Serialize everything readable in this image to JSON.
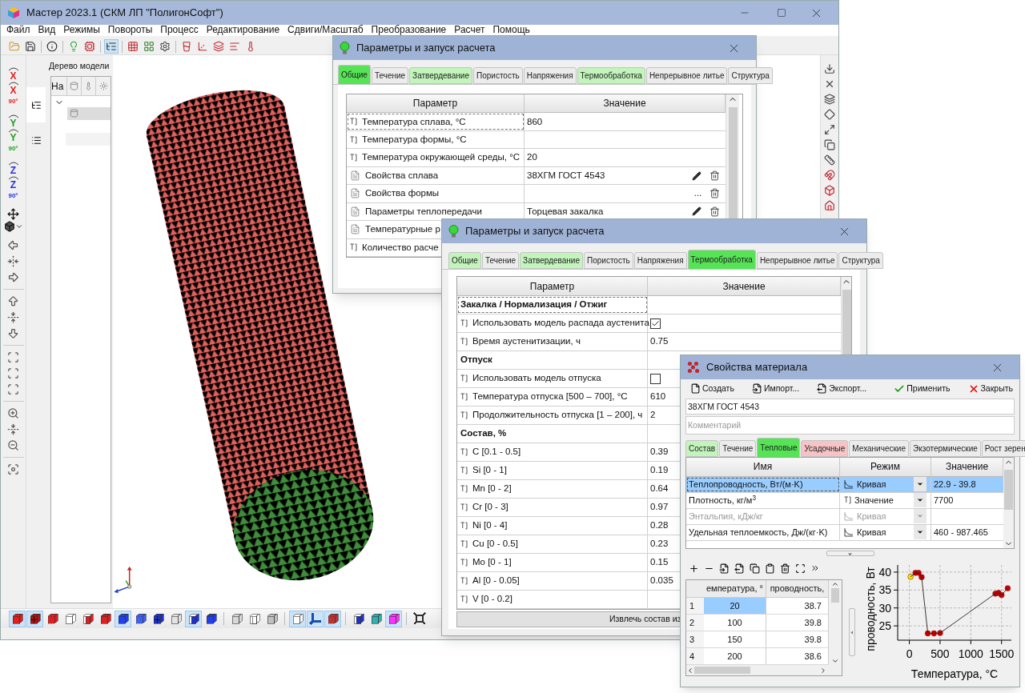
{
  "main_window": {
    "title": "Мастер 2023.1 (СКМ ЛП \"ПолигонСофт\")"
  },
  "menu": [
    "Файл",
    "Вид",
    "Режимы",
    "Повороты",
    "Процесс",
    "Редактирование",
    "Сдвиги/Масштаб",
    "Преобразование",
    "Расчет",
    "Помощь"
  ],
  "main_toolbar": [
    {
      "kind": "open",
      "pressed": false
    },
    {
      "kind": "save",
      "pressed": false
    },
    {
      "kind": "separator"
    },
    {
      "kind": "info",
      "pressed": false
    },
    {
      "kind": "separator"
    },
    {
      "kind": "bulb",
      "pressed": false
    },
    {
      "kind": "chip",
      "pressed": false
    },
    {
      "kind": "separator"
    },
    {
      "kind": "tree",
      "pressed": true
    },
    {
      "kind": "separator"
    },
    {
      "kind": "grid",
      "pressed": false
    },
    {
      "kind": "colors",
      "pressed": false
    },
    {
      "kind": "gear",
      "pressed": false
    },
    {
      "kind": "separator"
    },
    {
      "kind": "glass",
      "pressed": false
    },
    {
      "kind": "axes",
      "pressed": false
    },
    {
      "kind": "dots",
      "pressed": false
    },
    {
      "kind": "bars",
      "pressed": false
    },
    {
      "kind": "thermo",
      "pressed": false
    }
  ],
  "rotation_tools": [
    {
      "letters": [
        "X",
        "X"
      ],
      "angle": "90°",
      "color": "#e02020"
    },
    {
      "letters": [
        "Y",
        "Y"
      ],
      "angle": "90°",
      "color": "#1fa01f"
    },
    {
      "letters": [
        "Z",
        "Z"
      ],
      "angle": "90°",
      "color": "#2030e0"
    }
  ],
  "model_tree": {
    "title": "Дерево модели",
    "column_1": "На"
  },
  "view_toolbar": [
    {
      "kind": "solid",
      "color": "#e02020",
      "pressed": true
    },
    {
      "kind": "mesh",
      "color": "#b01010",
      "pressed": true
    },
    {
      "kind": "dots",
      "color": "#e02020",
      "pressed": false
    },
    {
      "kind": "solid",
      "color": "#ffffff",
      "pressed": false
    },
    {
      "kind": "half",
      "color": "#e02020",
      "pressed": false
    },
    {
      "kind": "double",
      "color": "#e02020",
      "pressed": false
    },
    {
      "kind": "solid",
      "color": "#2040f0",
      "pressed": true
    },
    {
      "kind": "dots",
      "color": "#4060f0",
      "pressed": false
    },
    {
      "kind": "mesh",
      "color": "#2030d0",
      "pressed": false
    },
    {
      "kind": "solid",
      "color": "#e4e4e4",
      "pressed": false
    },
    {
      "kind": "half",
      "color": "#2030d0",
      "pressed": true
    },
    {
      "kind": "double",
      "color": "#2040f0",
      "pressed": false
    },
    {
      "kind": "solid",
      "color": "#d8d8d8",
      "pressed": false
    },
    {
      "kind": "half",
      "color": "#ffffff",
      "pressed": false
    },
    {
      "kind": "solid",
      "color": "#c0c0c0",
      "pressed": false
    },
    {
      "kind": "solid",
      "color": "#ffffff",
      "pressed": true
    },
    {
      "kind": "axes",
      "color": "#1a4fb0",
      "pressed": true
    },
    {
      "kind": "dots",
      "color": "#c03030",
      "pressed": true
    },
    {
      "kind": "half",
      "color": "#2030d0",
      "pressed": false
    },
    {
      "kind": "solid",
      "color": "#30b0b0",
      "pressed": false
    },
    {
      "kind": "solid",
      "color": "#ff30ff",
      "pressed": true
    },
    {
      "kind": "fit",
      "color": "#303030",
      "pressed": false
    }
  ],
  "params_dialog_1": {
    "title": "Параметры и запуск расчета",
    "tabs": [
      {
        "label": "Общие",
        "selected": true,
        "color": "#56e356"
      },
      {
        "label": "Течение",
        "selected": false,
        "color": "#ececec"
      },
      {
        "label": "Затвердевание",
        "selected": false,
        "color": "#c2f4bb"
      },
      {
        "label": "Пористость",
        "selected": false,
        "color": "#ececec"
      },
      {
        "label": "Напряжения",
        "selected": false,
        "color": "#ececec"
      },
      {
        "label": "Термообработка",
        "selected": false,
        "color": "#c2f4bb"
      },
      {
        "label": "Непрерывное литье",
        "selected": false,
        "color": "#ececec"
      },
      {
        "label": "Структура",
        "selected": false,
        "color": "#ececec"
      }
    ],
    "columns": [
      "Параметр",
      "Значение"
    ],
    "rows": [
      {
        "kind": "value",
        "name": "Температура сплава, °C",
        "value": "860",
        "focused": true
      },
      {
        "kind": "value",
        "name": "Температура формы, °C",
        "focused": false
      },
      {
        "kind": "value",
        "name": "Температура окружающей среды, °C",
        "value": "20",
        "focused": false
      },
      {
        "kind": "file",
        "name": "Свойства сплава",
        "value": "38ХГМ ГОСТ 4543",
        "focused": false,
        "actions": [
          {
            "kind": "edit"
          },
          {
            "kind": "delete"
          }
        ]
      },
      {
        "kind": "file",
        "name": "Свойства формы",
        "focused": false,
        "actions": [
          {
            "kind": "more",
            "text": "..."
          },
          {
            "kind": "delete"
          }
        ]
      },
      {
        "kind": "file",
        "name": "Параметры теплопередачи",
        "value": "Торцевая закалка",
        "focused": false,
        "actions": [
          {
            "kind": "edit"
          },
          {
            "kind": "delete"
          }
        ]
      },
      {
        "kind": "file",
        "name": "Температурные р",
        "focused": false
      },
      {
        "kind": "value",
        "name": "Количество расче",
        "focused": false
      }
    ]
  },
  "params_dialog_2": {
    "title": "Параметры и запуск расчета",
    "tabs": [
      {
        "label": "Общие",
        "selected": false,
        "color": "#c2f4bb"
      },
      {
        "label": "Течение",
        "selected": false,
        "color": "#ececec"
      },
      {
        "label": "Затвердевание",
        "selected": false,
        "color": "#c2f4bb"
      },
      {
        "label": "Пористость",
        "selected": false,
        "color": "#ececec"
      },
      {
        "label": "Напряжения",
        "selected": false,
        "color": "#ececec"
      },
      {
        "label": "Термообработка",
        "selected": true,
        "color": "#56e356"
      },
      {
        "label": "Непрерывное литье",
        "selected": false,
        "color": "#ececec"
      },
      {
        "label": "Структура",
        "selected": false,
        "color": "#ececec"
      }
    ],
    "columns": [
      "Параметр",
      "Значение"
    ],
    "rows": [
      {
        "kind": "section",
        "name": "Закалка / Нормализация / Отжиг",
        "focused": true
      },
      {
        "kind": "check",
        "name": "Использовать модель распада аустенита",
        "checked": true,
        "focused": false
      },
      {
        "kind": "value",
        "name": "Время аустенитизации, ч",
        "value": "0.75",
        "focused": false
      },
      {
        "kind": "section",
        "name": "Отпуск",
        "focused": false
      },
      {
        "kind": "check",
        "name": "Использовать модель отпуска",
        "checked": false,
        "focused": false
      },
      {
        "kind": "value",
        "name": "Температура отпуска [500 – 700], °C",
        "value": "610",
        "focused": false
      },
      {
        "kind": "value",
        "name": "Продолжительность отпуска [1 – 200], ч",
        "value": "2",
        "focused": false
      },
      {
        "kind": "section",
        "name": "Состав, %",
        "focused": false
      },
      {
        "kind": "value",
        "name": "C [0.1 - 0.5]",
        "value": "0.39",
        "focused": false
      },
      {
        "kind": "value",
        "name": "Si [0 - 1]",
        "value": "0.19",
        "focused": false
      },
      {
        "kind": "value",
        "name": "Mn [0 - 2]",
        "value": "0.64",
        "focused": false
      },
      {
        "kind": "value",
        "name": "Cr [0 - 3]",
        "value": "0.97",
        "focused": false
      },
      {
        "kind": "value",
        "name": "Ni [0 - 4]",
        "value": "0.28",
        "focused": false
      },
      {
        "kind": "value",
        "name": "Cu [0 - 0.5]",
        "value": "0.23",
        "focused": false
      },
      {
        "kind": "value",
        "name": "Mo [0 - 1]",
        "value": "0.15",
        "focused": false
      },
      {
        "kind": "value",
        "name": "Al [0 - 0.05]",
        "value": "0.035",
        "focused": false
      },
      {
        "kind": "value",
        "name": "V [0 - 0.2]",
        "focused": false
      }
    ],
    "extract_button": "Извлечь состав из"
  },
  "material_dialog": {
    "title": "Свойства материала",
    "toolbar": [
      {
        "kind": "new",
        "label": "Создать"
      },
      {
        "kind": "import",
        "label": "Импорт..."
      },
      {
        "kind": "export",
        "label": "Экспорт..."
      },
      {
        "kind": "apply",
        "label": "Применить"
      },
      {
        "kind": "close",
        "label": "Закрыть"
      }
    ],
    "name": {
      "value": "38ХГМ ГОСТ 4543"
    },
    "comment": {
      "placeholder": "Комментарий"
    },
    "tabs": [
      {
        "label": "Состав",
        "selected": false,
        "color": "#c2f4bb"
      },
      {
        "label": "Течение",
        "selected": false,
        "color": "#ececec"
      },
      {
        "label": "Тепловые",
        "selected": true,
        "color": "#56e356"
      },
      {
        "label": "Усадочные",
        "selected": false,
        "color": "#f6c4c4"
      },
      {
        "label": "Механические",
        "selected": false,
        "color": "#ececec"
      },
      {
        "label": "Экзотермические",
        "selected": false,
        "color": "#ececec"
      },
      {
        "label": "Рост зерен",
        "selected": false,
        "color": "#ececec"
      }
    ],
    "columns": [
      "Имя",
      "Режим",
      "Значение"
    ],
    "rows": [
      {
        "name": "Теплопроводность, Вт/(м·K)",
        "mode": {
          "kind": "curve",
          "label": "Кривая"
        },
        "value": "22.9 - 39.8",
        "selected": true,
        "disabled": false
      },
      {
        "name": "Плотность, кг/м$^{3}$",
        "mode": {
          "kind": "value",
          "label": "Значение"
        },
        "value": "7700",
        "selected": false,
        "disabled": false
      },
      {
        "name": "Энтальпия, кДж/кг",
        "mode": {
          "kind": "curve",
          "label": "Кривая"
        },
        "selected": false,
        "disabled": true
      },
      {
        "name": "Удельная теплоемкость, Дж/(кг·K)",
        "mode": {
          "kind": "curve",
          "label": "Кривая"
        },
        "value": "460 - 987.465",
        "selected": false,
        "disabled": false
      }
    ],
    "data_table": {
      "columns": [
        "емпература, °",
        "проводность,"
      ],
      "rows": [
        {
          "number": "1",
          "cells": [
            {
              "text": "20",
              "selected": true
            },
            {
              "text": "38.7",
              "selected": false
            }
          ]
        },
        {
          "number": "2",
          "cells": [
            {
              "text": "100",
              "selected": false
            },
            {
              "text": "39.8",
              "selected": false
            }
          ]
        },
        {
          "number": "3",
          "cells": [
            {
              "text": "150",
              "selected": false
            },
            {
              "text": "39.8",
              "selected": false
            }
          ]
        },
        {
          "number": "4",
          "cells": [
            {
              "text": "200",
              "selected": false
            },
            {
              "text": "38.6",
              "selected": false
            }
          ]
        }
      ]
    },
    "chart": {
      "chart_data": {
        "type": "line",
        "xlabel": "Температура, °C",
        "ylabel": "проводность, Вт",
        "x": [
          20,
          100,
          150,
          200,
          300,
          400,
          500,
          1400,
          1450,
          1500,
          1600
        ],
        "grid": true,
        "series": [
          {
            "color": "#222222",
            "marker": "circle",
            "values": [
              38.7,
              39.8,
              39.8,
              38.6,
              22.9,
              22.9,
              23,
              34,
              34.2,
              33.6,
              35.5
            ]
          }
        ],
        "xlim": [
          -190,
          1660
        ],
        "ylim": [
          21,
          42
        ],
        "xticks": [
          0,
          500,
          1000,
          1500
        ],
        "yticks": [
          25,
          30,
          35,
          40
        ]
      }
    }
  }
}
